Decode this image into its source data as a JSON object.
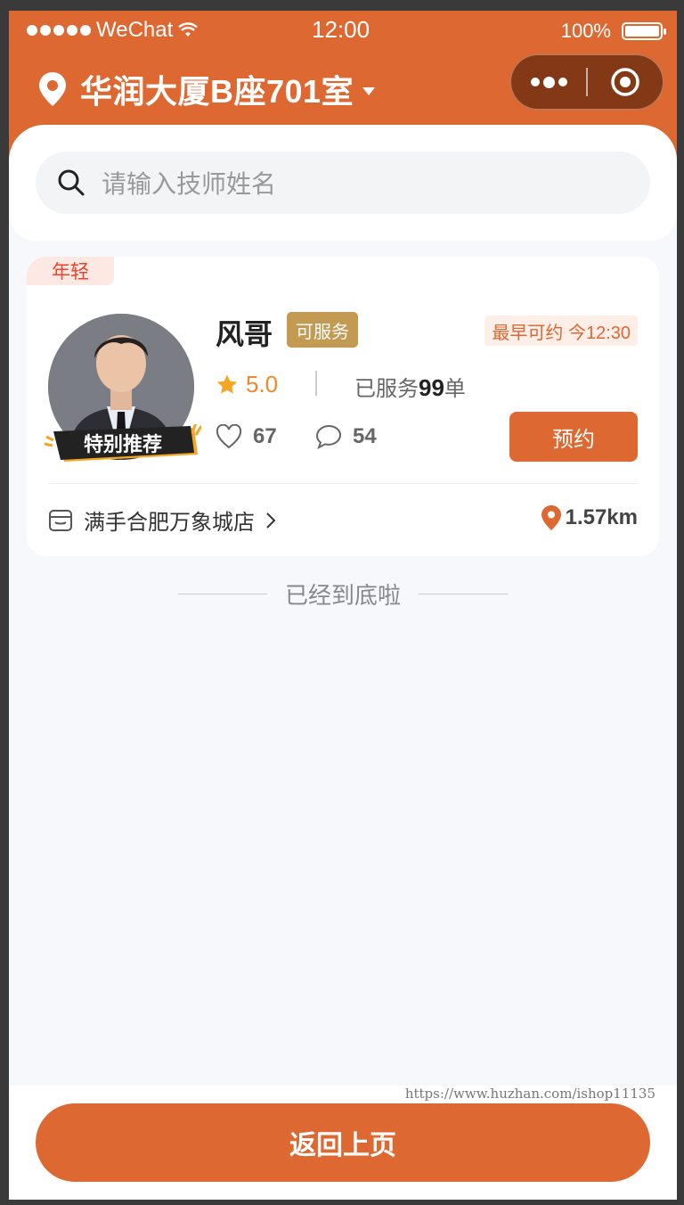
{
  "status_bar": {
    "carrier": "WeChat",
    "time": "12:00",
    "battery": "100%"
  },
  "location": {
    "text": "华润大厦B座701室"
  },
  "search": {
    "placeholder": "请输入技师姓名"
  },
  "technician": {
    "tag": "年轻",
    "badge": "特别推荐",
    "name": "风哥",
    "status": "可服务",
    "earliest": "最早可约 今12:30",
    "rating": "5.0",
    "served_prefix": "已服务",
    "served_count": "99",
    "served_suffix": "单",
    "likes": "67",
    "comments": "54",
    "book_label": "预约",
    "store": "满手合肥万象城店",
    "distance": "1.57km"
  },
  "list_end": "已经到底啦",
  "watermark": "https://www.huzhan.com/ishop11135",
  "back_button": "返回上页",
  "colors": {
    "brand": "#de6832",
    "available": "#c39a52",
    "star": "#f0882c"
  }
}
